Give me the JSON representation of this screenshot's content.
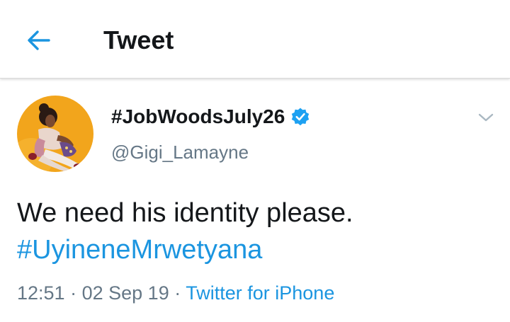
{
  "header": {
    "title": "Tweet",
    "back_icon": "arrow-left-icon",
    "accent_color": "#1b95e0"
  },
  "tweet": {
    "display_name": "#JobWoodsJuly26",
    "verified_icon": "verified-badge-icon",
    "handle": "@Gigi_Lamayne",
    "caret_icon": "chevron-down-icon",
    "text_line_1": "We need his identity please.",
    "hashtag": "#UyineneMrwetyana",
    "time": "12:51",
    "separator": "·",
    "date": "02 Sep 19",
    "source": "Twitter for iPhone"
  },
  "colors": {
    "text": "#14171a",
    "secondary": "#657786",
    "link": "#1b95e0",
    "avatar_bg": "#f2a51c"
  }
}
